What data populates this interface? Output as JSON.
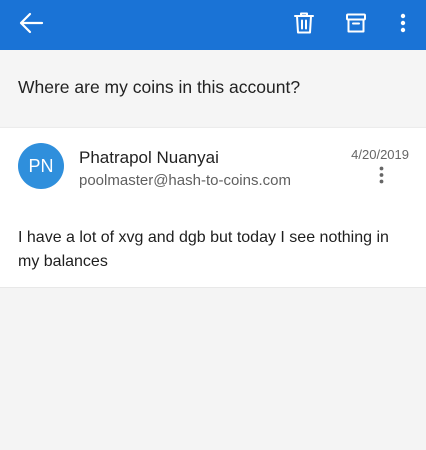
{
  "toolbar": {
    "back_icon": "arrow-left-icon",
    "delete_icon": "trash-icon",
    "archive_icon": "archive-icon",
    "more_icon": "more-vertical-icon"
  },
  "email": {
    "subject": "Where are my coins in this account?",
    "sender": {
      "initials": "PN",
      "name": "Phatrapol Nuanyai",
      "email": "poolmaster@hash-to-coins.com"
    },
    "date": "4/20/2019",
    "body": "I have a lot of xvg and dgb but today I see nothing in my balances"
  },
  "colors": {
    "toolbar": "#1a73d6",
    "avatar": "#2f8fdc",
    "background": "#f4f4f4",
    "card": "#ffffff"
  }
}
